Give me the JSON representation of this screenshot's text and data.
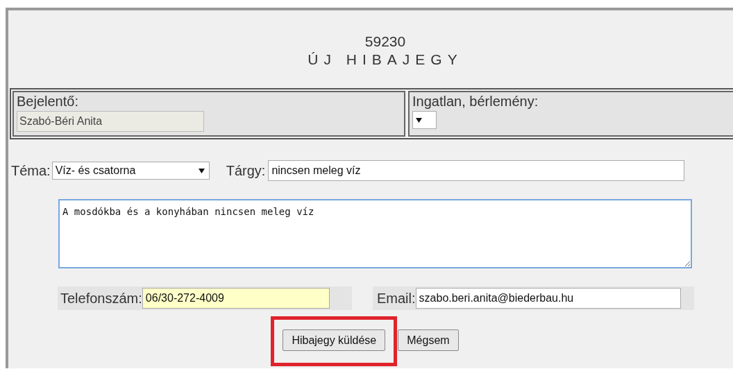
{
  "header": {
    "number": "59230",
    "title": "ÚJ HIBAJEGY"
  },
  "reporter": {
    "label": "Bejelentő:",
    "value": "Szabó-Béri Anita",
    "disabled": true
  },
  "property": {
    "label": "Ingatlan, bérlemény:"
  },
  "topic": {
    "label": "Téma:",
    "value": "Víz- és csatorna"
  },
  "subject": {
    "label": "Tárgy:",
    "value": "nincsen meleg víz"
  },
  "description": {
    "value": "A mosdókba és a konyhában nincsen meleg víz",
    "focused": true
  },
  "phone": {
    "label": "Telefonszám:",
    "value": "06/30-272-4009",
    "autofilled": true
  },
  "email": {
    "label": "Email:",
    "value": "szabo.beri.anita@biederbau.hu"
  },
  "buttons": [
    {
      "label": "Hibajegy küldése",
      "highlighted": true
    },
    {
      "label": "Mégsem",
      "highlighted": false
    }
  ]
}
